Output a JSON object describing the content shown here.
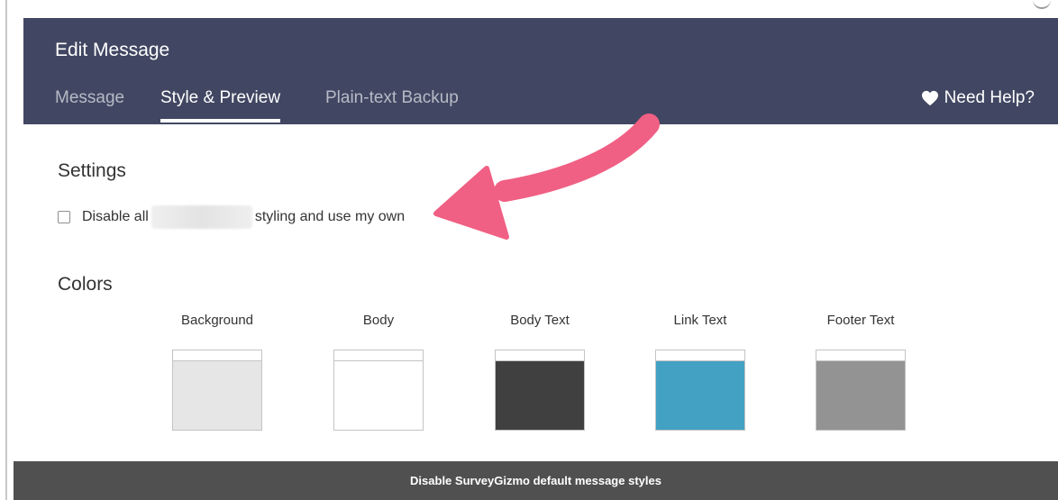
{
  "header": {
    "title": "Edit Message",
    "tabs": [
      {
        "label": "Message",
        "active": false
      },
      {
        "label": "Style & Preview",
        "active": true
      },
      {
        "label": "Plain-text Backup",
        "active": false
      }
    ],
    "help_label": "Need Help?",
    "background_color": "#414762"
  },
  "settings": {
    "title": "Settings",
    "checkbox_checked": false,
    "option_prefix": "Disable all",
    "option_suffix": "styling and use my own"
  },
  "colors": {
    "title": "Colors",
    "swatches": [
      {
        "label": "Background",
        "color": "#e6e6e6"
      },
      {
        "label": "Body",
        "color": "#ffffff"
      },
      {
        "label": "Body Text",
        "color": "#404040"
      },
      {
        "label": "Link Text",
        "color": "#43a1c4"
      },
      {
        "label": "Footer Text",
        "color": "#939393"
      }
    ]
  },
  "annotation": {
    "arrow_color": "#f06084"
  },
  "caption": {
    "text": "Disable SurveyGizmo default message styles"
  }
}
